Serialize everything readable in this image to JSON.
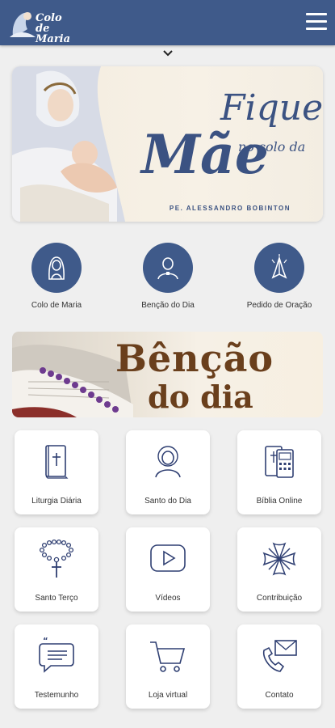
{
  "header": {
    "logo_text": "Colo de\nMaria",
    "menu_icon": "hamburger-menu-icon",
    "colors": {
      "bar": "#3f5a8a"
    }
  },
  "hero": {
    "line1": "Fique",
    "line_small": "no colo da",
    "line2": "Mãe",
    "subtitle": "PE. ALESSANDRO BOBINTON"
  },
  "shortcuts": [
    {
      "label": "Colo de Maria",
      "icon": "mary-icon"
    },
    {
      "label": "Benção do Dia",
      "icon": "priest-icon"
    },
    {
      "label": "Pedido de Oração",
      "icon": "praying-hands-icon"
    }
  ],
  "banner": {
    "line1": "Bênção",
    "line2": "do dia"
  },
  "grid": [
    {
      "label": "Liturgia Diária",
      "icon": "bible-icon"
    },
    {
      "label": "Santo do Dia",
      "icon": "saint-icon"
    },
    {
      "label": "Bíblia Online",
      "icon": "tablet-bible-icon"
    },
    {
      "label": "Santo Terço",
      "icon": "rosary-icon"
    },
    {
      "label": "Vídeos",
      "icon": "play-icon"
    },
    {
      "label": "Contribuição",
      "icon": "cross-icon"
    },
    {
      "label": "Testemunho",
      "icon": "chat-icon"
    },
    {
      "label": "Loja virtual",
      "icon": "cart-icon"
    },
    {
      "label": "Contato",
      "icon": "phone-mail-icon"
    }
  ]
}
